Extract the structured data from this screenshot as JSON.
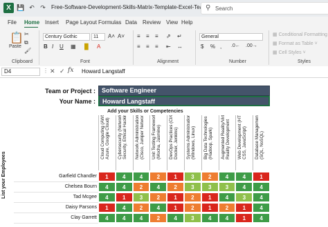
{
  "window": {
    "filename": "Free-Software-Development-Skills-Matrix-Template-Excel-Team-Capability.xlsx",
    "filename_suffix": "⌄",
    "search_placeholder": "Search"
  },
  "menu": {
    "items": [
      "File",
      "Home",
      "Insert",
      "Page Layout",
      "Formulas",
      "Data",
      "Review",
      "View",
      "Help"
    ],
    "active": "Home"
  },
  "ribbon": {
    "paste_label": "Paste",
    "clipboard_label": "Clipboard",
    "font_name": "Century Gothic",
    "font_size": "11",
    "font_label": "Font",
    "alignment_label": "Alignment",
    "number_format": "General",
    "number_label": "Number",
    "styles": [
      "Conditional Formatting",
      "Format as Table",
      "Cell Styles"
    ],
    "styles_label": "Styles"
  },
  "formula_bar": {
    "cell_ref": "D4",
    "content": "Howard Langstaff"
  },
  "sheet": {
    "team_label": "Team or Project :",
    "team_value": "Software Engineer",
    "name_label": "Your Name :",
    "name_value": "Howard Langstaff",
    "skills_heading": "Add your Skills or Competencies",
    "employees_heading": "List your Employees",
    "skills": [
      "Cloud Computing (AWS, Azure, Google Cloud)",
      "Cybersecurity (Network Security, Ethical Hacking)",
      "Network Administration (Cisco, Juniper Networks)",
      "Unit Testing Frameworks (Mocha, Jasmine)",
      "DevOps Practices (CI/CD, Docker, Jenkins)",
      "Systems Administration (Windows, Linux)",
      "Big Data Technologies (Hadoop, Spark)",
      "Augmented Reality/Virtual Reality Development",
      "Web Development (HTML, CSS, JavaScript)",
      "Database Management (SQL, NoSQL)"
    ],
    "employees": [
      {
        "name": "Garfield Chandler",
        "scores": [
          "1",
          "4",
          "4",
          "2",
          "1",
          "3",
          "2",
          "4",
          "4",
          "1"
        ]
      },
      {
        "name": "Chelsea Bourn",
        "scores": [
          "4",
          "4",
          "2",
          "4",
          "2",
          "3",
          "3",
          "3",
          "4",
          "4"
        ]
      },
      {
        "name": "Tad Mcgee",
        "scores": [
          "4",
          "1",
          "3",
          "2",
          "1",
          "2",
          "1",
          "4",
          "3",
          "4"
        ]
      },
      {
        "name": "Daisy Parsons",
        "scores": [
          "1",
          "4",
          "2",
          "4",
          "1",
          "2",
          "1",
          "2",
          "1",
          "4"
        ]
      },
      {
        "name": "Clay Garrett",
        "scores": [
          "4",
          "4",
          "4",
          "2",
          "4",
          "3",
          "4",
          "4",
          "1",
          "4"
        ]
      }
    ],
    "score_colors": {
      "1": "#d9261c",
      "2": "#ee7d31",
      "3": "#8fc04b",
      "4": "#3e9c47"
    }
  }
}
